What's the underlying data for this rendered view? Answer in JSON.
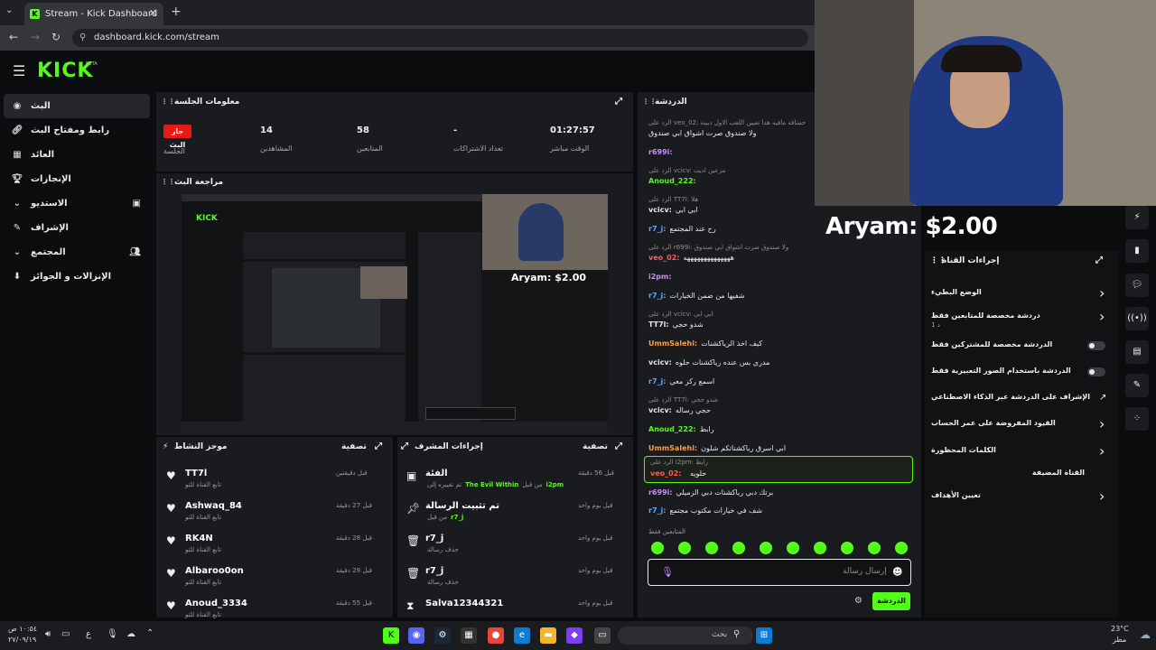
{
  "browser": {
    "tab_title": "Stream - Kick Dashboard",
    "url": "dashboard.kick.com/stream"
  },
  "header": {
    "logo": "KICK",
    "beta": "BETA"
  },
  "sidebar": {
    "items": [
      {
        "label": "البث"
      },
      {
        "label": "رابط ومفتاح البث"
      },
      {
        "label": "العائد"
      },
      {
        "label": "الإنجازات"
      },
      {
        "label": "الاستديو"
      },
      {
        "label": "الإشراف"
      },
      {
        "label": "المجتمع"
      },
      {
        "label": "الإنزالات و الجوائز"
      }
    ]
  },
  "session": {
    "title": "معلومات الجلسة",
    "live_badge": "جار البث",
    "session_label": "الجلسة",
    "stats": [
      {
        "value": "14",
        "label": "المشاهدين"
      },
      {
        "value": "58",
        "label": "المتابعين"
      },
      {
        "value": "-",
        "label": "تعداد الاشتراكات"
      },
      {
        "value": "01:27:57",
        "label": "الوقت مباشر"
      }
    ]
  },
  "preview": {
    "title": "مراجعة البث",
    "overlay_text": "Aryam: $2.00",
    "inner_logo": "KICK"
  },
  "activity": {
    "title": "موجز النشاط",
    "filter_label": "تصفية",
    "items": [
      {
        "name": "TT7l",
        "sub": "تابع القناة للتو",
        "time": "قبل دقيقتين"
      },
      {
        "name": "Ashwaq_84",
        "sub": "تابع القناة للتو",
        "time": "قبل 27 دقيقة"
      },
      {
        "name": "RK4N",
        "sub": "تابع القناة للتو",
        "time": "قبل 28 دقيقة"
      },
      {
        "name": "Albaroo0on",
        "sub": "تابع القناة للتو",
        "time": "قبل 29 دقيقة"
      },
      {
        "name": "Anoud_3334",
        "sub": "تابع القناة للتو",
        "time": "قبل 55 دقيقة"
      }
    ]
  },
  "mod_actions": {
    "title": "إجراءات المشرف",
    "filter_label": "تصفية",
    "items": [
      {
        "name": "الفئة",
        "sub_prefix": "تم تغييره إلى",
        "highlight": "The Evil Within",
        "sub_suffix": "من قبل",
        "by": "i2pm",
        "time": "قبل 56 دقيقة"
      },
      {
        "name": "تم تثبيت الرسالة",
        "sub_prefix": "من قبل",
        "highlight": "",
        "sub_suffix": "",
        "by": "r7_j",
        "time": "قبل يوم واحد"
      },
      {
        "name": "r7_j",
        "sub_prefix": "حذف رسالة",
        "highlight": "",
        "sub_suffix": "",
        "by": "",
        "time": "قبل يوم واحد"
      },
      {
        "name": "r7_j",
        "sub_prefix": "حذف رسالة",
        "highlight": "",
        "sub_suffix": "",
        "by": "",
        "time": "قبل يوم واحد"
      },
      {
        "name": "Salva12344321",
        "sub_prefix": "",
        "highlight": "",
        "sub_suffix": "",
        "by": "",
        "time": "قبل يوم واحد"
      }
    ]
  },
  "chat": {
    "title": "الدردشة",
    "followers_only": "المتابعين فقط",
    "input_placeholder": "إرسال رسالة",
    "send_label": "الدردشة",
    "messages": [
      {
        "reply": "الرد على veo_02: حسافه مافيه هدا تعيين اللعب الاول دبيبه",
        "user": "",
        "text": "ولا صندوق صرت اشواق ابي صندوق",
        "color": "#e8e8e8"
      },
      {
        "reply": "",
        "user": "r699i:",
        "text": "",
        "color": "#c98cff"
      },
      {
        "reply": "الرد على vcicv: مزعين اديت",
        "user": "",
        "text": "",
        "color": "#e8e8e8"
      },
      {
        "reply": "",
        "user": "Anoud_222:",
        "text": "",
        "color": "#53fc18"
      },
      {
        "reply": "الرد على TT7l: هلا",
        "user": "vcicv:",
        "text": "ابي ابي",
        "color": "#e8e8e8"
      },
      {
        "reply": "",
        "user": "r7_j:",
        "text": "رح عند المجتمع",
        "color": "#55aaff"
      },
      {
        "reply": "الرد على r699i: ولا صندوق صرت اشواق ابي صندوق",
        "user": "veo_02:",
        "text": "ههههههههههههههه",
        "color": "#ff5a5a"
      },
      {
        "reply": "",
        "user": "i2pm:",
        "text": "",
        "color": "#c98cff"
      },
      {
        "reply": "",
        "user": "r7_j:",
        "text": "شفيها من ضمن الخيارات",
        "color": "#55aaff"
      },
      {
        "reply": "الرد على vcicv: ابي ابي",
        "user": "TT7l:",
        "text": "شدو حجي",
        "color": "#e8e8e8"
      },
      {
        "reply": "",
        "user": "UmmSalehi:",
        "text": "كيف اخذ الرياكشنات",
        "color": "#ff9e3d"
      },
      {
        "reply": "",
        "user": "vcicv:",
        "text": "مدري بس عنده رياكشنات حلوه",
        "color": "#e8e8e8"
      },
      {
        "reply": "",
        "user": "r7_j:",
        "text": "اسمع ركز معي",
        "color": "#55aaff"
      },
      {
        "reply": "الرد على TT7l: شدو حجي",
        "user": "vcicv:",
        "text": "حجي رساله",
        "color": "#e8e8e8"
      },
      {
        "reply": "",
        "user": "Anoud_222:",
        "text": "رابط",
        "color": "#53fc18"
      },
      {
        "reply": "",
        "user": "UmmSalehi:",
        "text": "ابي اسرق رياكشناتكم شلون",
        "color": "#ff9e3d"
      },
      {
        "reply": "",
        "user": "TT7l:",
        "text": "شكلك جديد",
        "color": "#e8e8e8"
      }
    ],
    "highlight": {
      "reply": "الرد على i2pm: رابط",
      "user": "veo_02:",
      "text": "حلويه"
    },
    "after": [
      {
        "user": "r699i:",
        "text": "برتك دبي رياكشنات دبي الزميلي",
        "color": "#c98cff"
      },
      {
        "user": "r7_j:",
        "text": "شف في خيارات مكتوب مجتمع",
        "color": "#55aaff"
      }
    ]
  },
  "webcam": {
    "alert": "Aryam: $2.00"
  },
  "channel_actions": {
    "title": "إجراءات القناة",
    "items": [
      {
        "label": "الوضع البطيء",
        "kind": "chevron"
      },
      {
        "label": "دردشة مخصصة للمتابعين فقط",
        "sub": "1 د",
        "kind": "chevron"
      },
      {
        "label": "الدردشة مخصصة للمشتركين فقط",
        "kind": "toggle"
      },
      {
        "label": "الدردشة باستخدام الصور التعبيرية فقط",
        "kind": "toggle"
      },
      {
        "label": "الإشراف على الدردشة عبر الذكاء الاصطناعي",
        "kind": "link"
      },
      {
        "label": "القيود المفروضة على عمر الحساب",
        "kind": "chevron"
      },
      {
        "label": "الكلمات المحظورة",
        "kind": "chevron"
      },
      {
        "label": "القناة المضيفة",
        "kind": "none"
      },
      {
        "label": "تعيين الأهداف",
        "kind": "chevron"
      }
    ]
  },
  "taskbar": {
    "time": "١٠:٥٤ ص",
    "date": "٢٧/٠٩/١٩",
    "lang": "ع",
    "search_placeholder": "بحث",
    "weather_temp": "23°C",
    "weather_desc": "مطر"
  },
  "colors": {
    "brand": "#53fc18",
    "live": "#e91916",
    "panel": "#191b1f",
    "bg": "#0b0c0d"
  }
}
